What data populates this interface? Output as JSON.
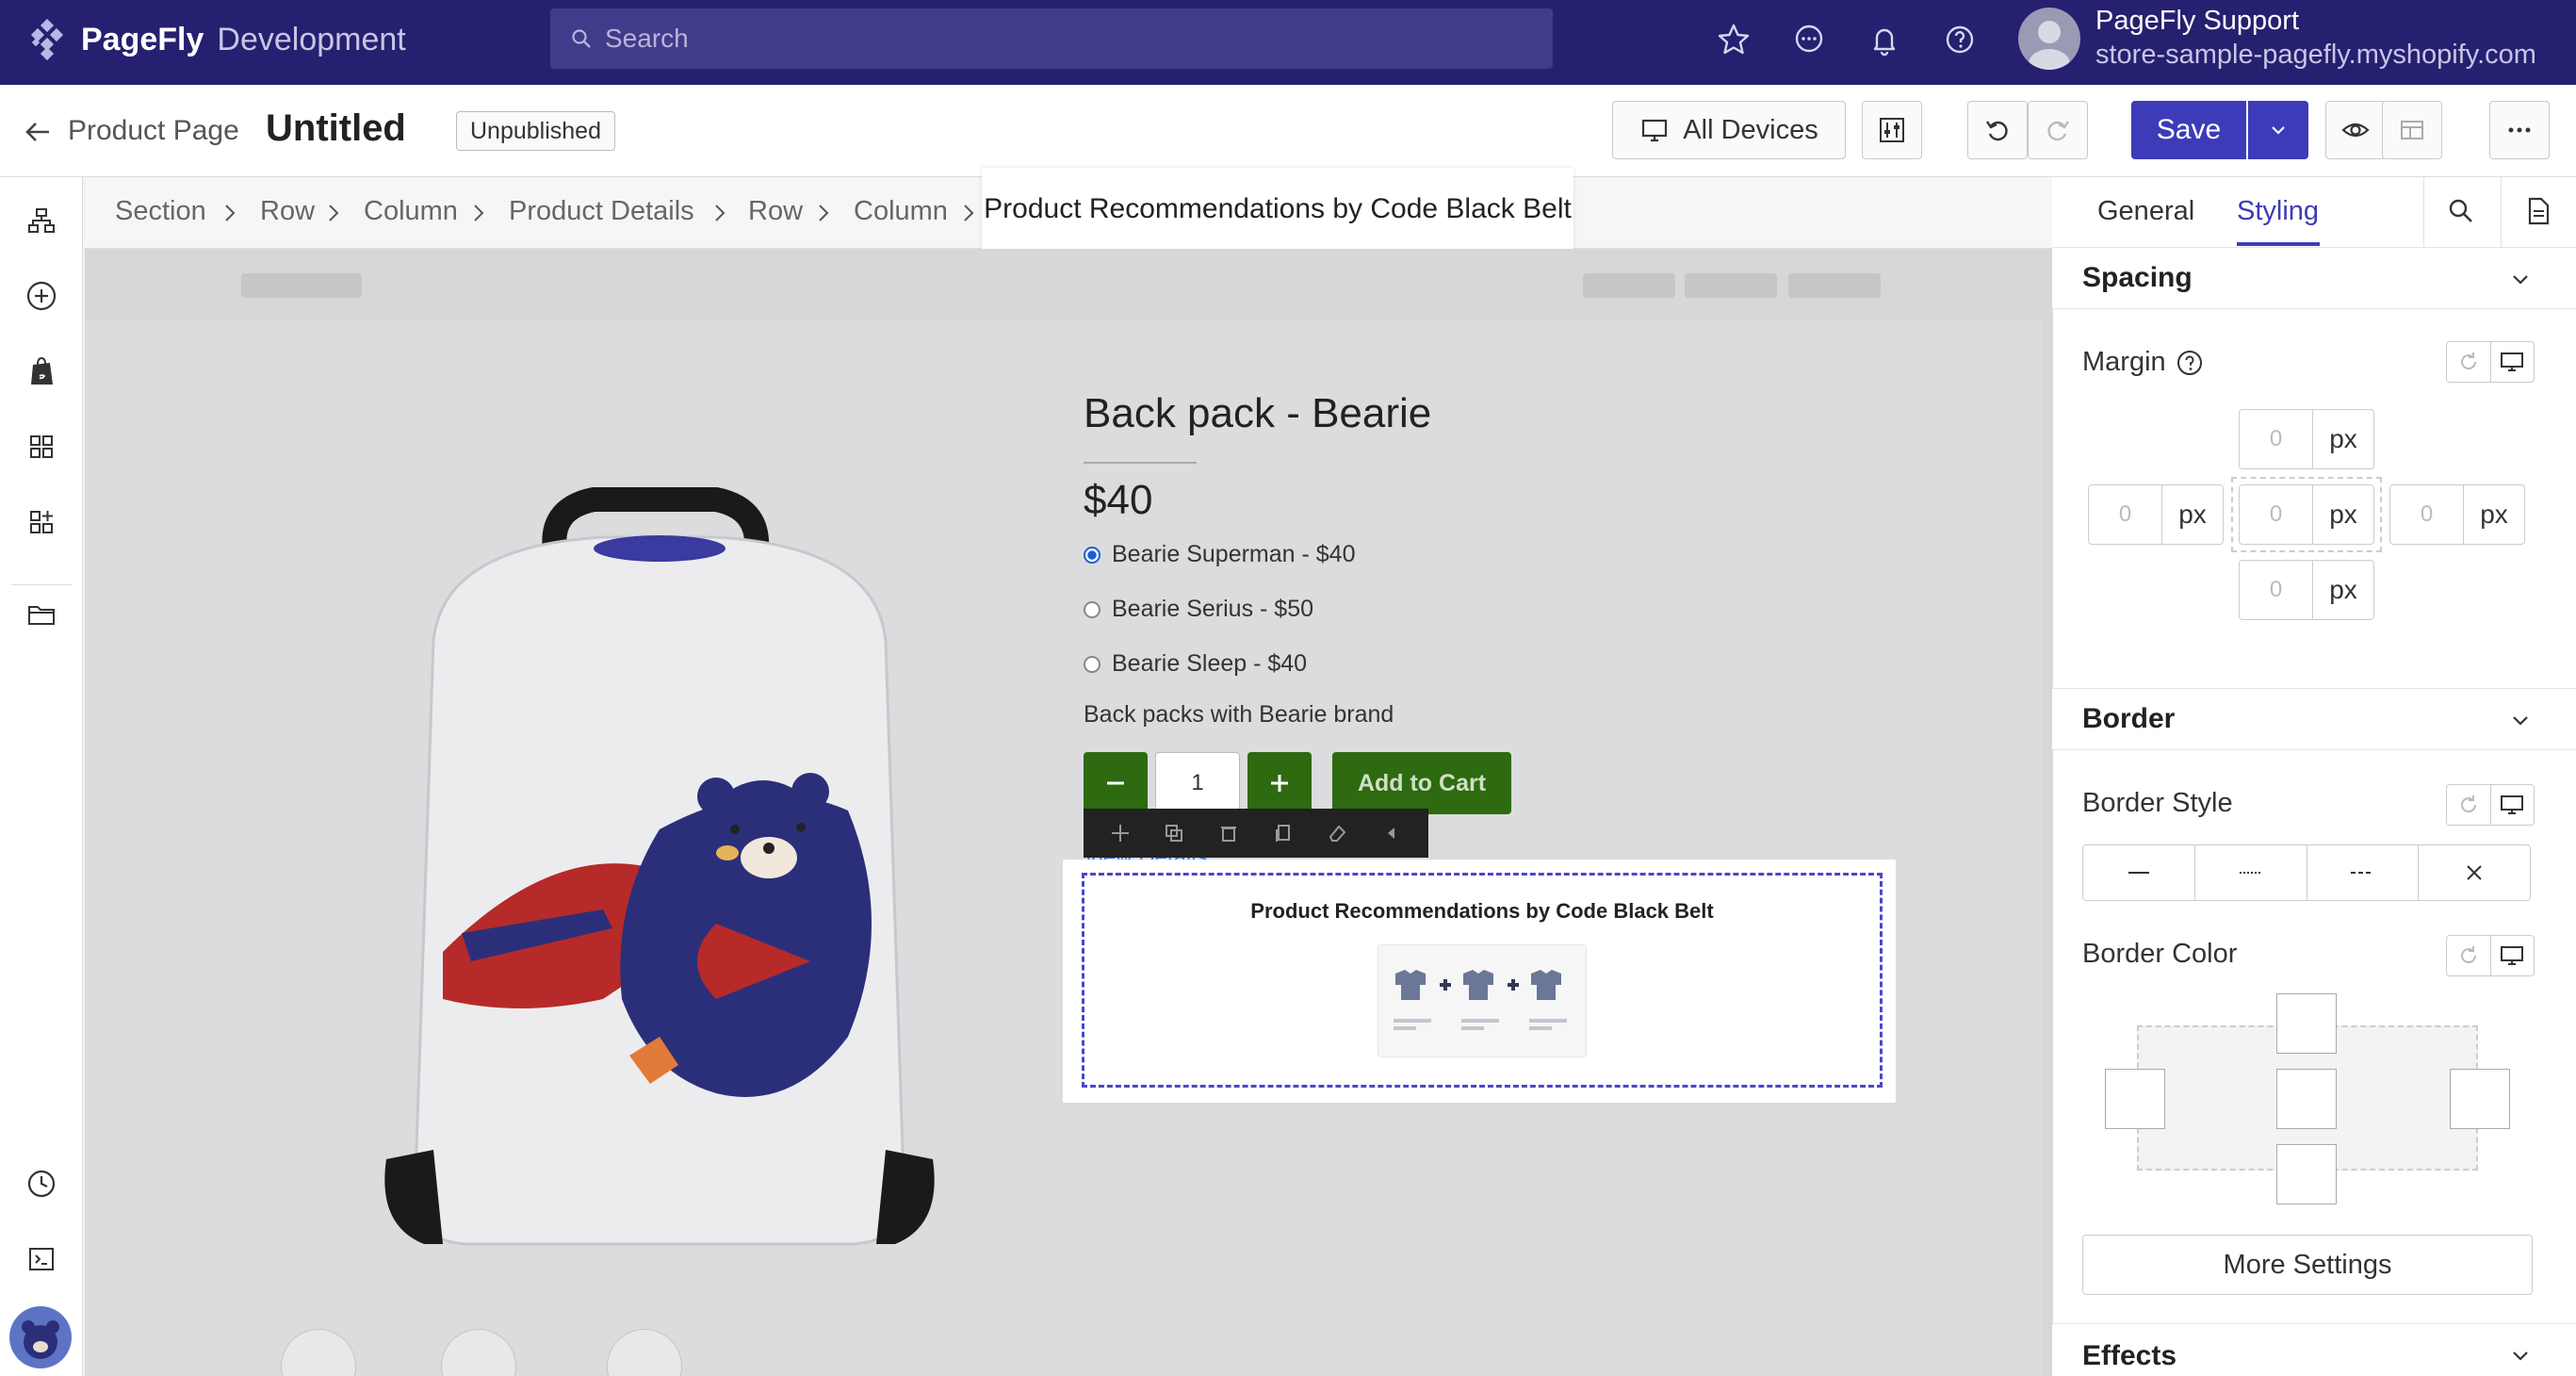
{
  "app": {
    "brand_name": "PageFly",
    "brand_suffix": "Development"
  },
  "search": {
    "placeholder": "Search"
  },
  "user": {
    "name": "PageFly Support",
    "store": "store-sample-pagefly.myshopify.com"
  },
  "editor_bar": {
    "back_label": "Product Page",
    "page_title": "Untitled",
    "status": "Unpublished",
    "devices_label": "All Devices",
    "save_label": "Save"
  },
  "breadcrumb": {
    "items": [
      "Section",
      "Row",
      "Column",
      "Product Details",
      "Row",
      "Column"
    ],
    "active": "Product Recommendations by Code Black Belt"
  },
  "product": {
    "title": "Back pack - Bearie",
    "price": "$40",
    "variants": [
      {
        "label": "Bearie Superman - $40",
        "selected": true
      },
      {
        "label": "Bearie Serius - $50",
        "selected": false
      },
      {
        "label": "Bearie Sleep - $40",
        "selected": false
      }
    ],
    "description": "Back packs with Bearie brand",
    "quantity": "1",
    "add_to_cart_label": "Add to Cart",
    "view_details_label": "View Details"
  },
  "recommendation_block": {
    "title": "Product Recommendations by Code Black Belt"
  },
  "panel": {
    "tabs": [
      "General",
      "Styling"
    ],
    "active_tab": "Styling",
    "spacing": {
      "title": "Spacing",
      "margin_label": "Margin",
      "margin": {
        "top": "0",
        "left": "0",
        "center": "0",
        "right": "0",
        "bottom": "0"
      },
      "unit": "px"
    },
    "border": {
      "title": "Border",
      "style_label": "Border Style",
      "color_label": "Border Color",
      "more_settings_label": "More Settings"
    },
    "effects": {
      "title": "Effects"
    }
  },
  "colors": {
    "topbar": "#25206f",
    "accent": "#3d3bb8",
    "cart_green": "#2d6a10",
    "selection": "#4a47c9"
  }
}
